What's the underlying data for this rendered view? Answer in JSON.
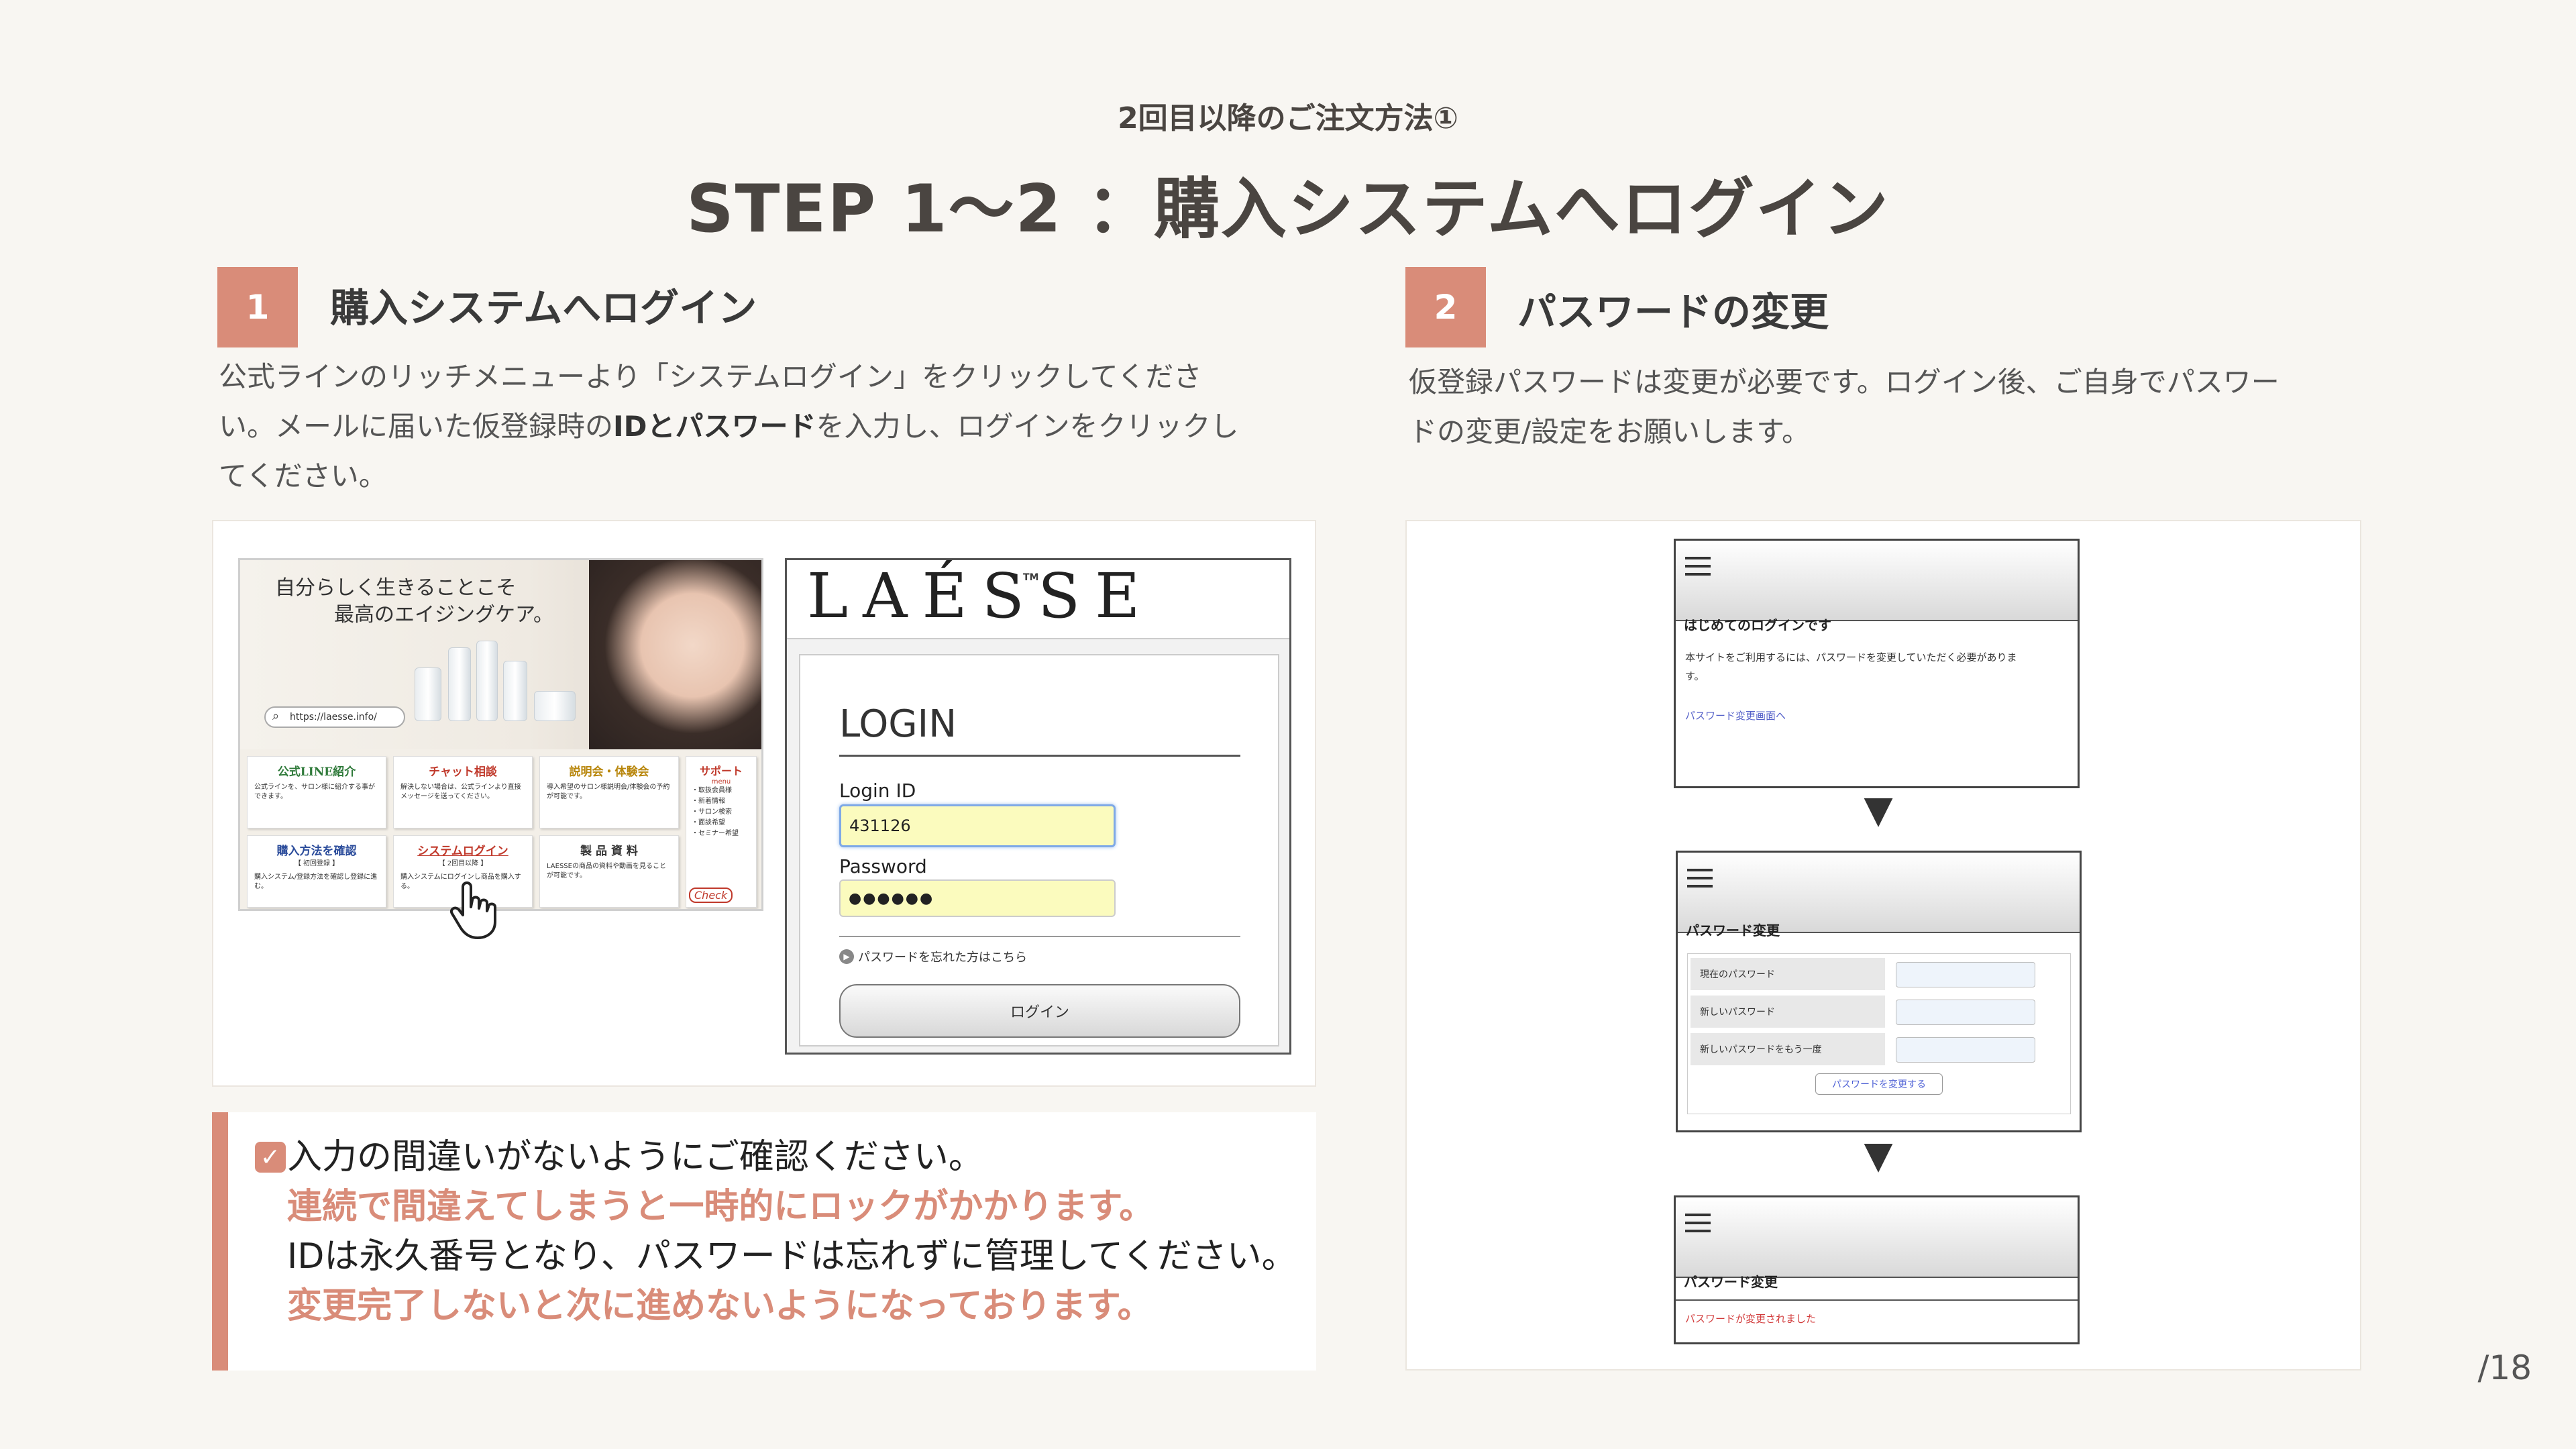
{
  "header": {
    "subtitle": "2回目以降のご注文方法①",
    "title": "STEP 1〜2 ：購入システムへログイン"
  },
  "step1": {
    "number": "1",
    "title": "購入システムへログイン",
    "desc_line1": "公式ラインのリッチメニューより「システムログイン」をクリックしてくださ",
    "desc_line2_a": "い。メールに届いた仮登録時の",
    "desc_line2_bold": "IDとパスワード",
    "desc_line2_b": "を入力し、ログインをクリックし",
    "desc_line3": "てください。"
  },
  "step2": {
    "number": "2",
    "title": "パスワードの変更",
    "desc_line1": "仮登録パスワードは変更が必要です。ログイン後、ご自身でパスワー",
    "desc_line2": "ドの変更/設定をお願いします。"
  },
  "richmenu": {
    "banner_line1": "自分らしく生きることこそ",
    "banner_line2": "最高のエイジングケア。",
    "url": "https://laesse.info/",
    "tiles": [
      {
        "title": "公式LINE紹介",
        "body": "公式ラインを、サロン様に紹介する事ができます。",
        "color": "#2f7a3a"
      },
      {
        "title": "チャット相談",
        "body": "解決しない場合は、公式ラインより直接メッセージを送ってください。",
        "color": "#c0392b"
      },
      {
        "title": "説明会・体験会",
        "body": "導入希望のサロン様説明会/体験会の予約が可能です。",
        "color": "#b8860b"
      },
      {
        "title": "購入方法を確認",
        "sub": "【 初回登録 】",
        "body": "購入システム/登録方法を確認し登録に進む。",
        "color": "#2b4c9b"
      },
      {
        "title": "システムログイン",
        "sub": "【 2回目以降 】",
        "body": "購入システムにログインし商品を購入する。",
        "color": "#c0392b"
      },
      {
        "title": "製 品 資 料",
        "body": "LAESSEの商品の資料や動画を見ることが可能です。",
        "color": "#333333"
      }
    ],
    "support_title": "サポート",
    "support_sub": "menu",
    "support_items": [
      "・取扱会員様",
      "・新着情報",
      "・サロン検索",
      "・面談希望",
      "・セミナー希望"
    ],
    "check_label": "Check"
  },
  "login": {
    "brand": "LAÉSSE",
    "tm": "TM",
    "heading": "LOGIN",
    "id_label": "Login ID",
    "id_value": "431126",
    "pw_label": "Password",
    "pw_value": "●●●●●●",
    "forgot": "パスワードを忘れた方はこちら",
    "button": "ログイン"
  },
  "notice": {
    "line1": "入力の間違いがないようにご確認ください。",
    "line2": "連続で間違えてしまうと一時的にロックがかかります。",
    "line3": "IDは永久番号となり、パスワードは忘れずに管理してください。",
    "line4": "変更完了しないと次に進めないようになっております。"
  },
  "phone1": {
    "title": "はじめてのログインです",
    "text_line1": "本サイトをご利用するには、パスワードを変更していただく必要がありま",
    "text_line2": "す。",
    "link": "パスワード変更画面へ"
  },
  "phone2": {
    "title": "パスワード変更",
    "rows": [
      "現在のパスワード",
      "新しいパスワード",
      "新しいパスワードをもう一度"
    ],
    "button": "パスワードを変更する"
  },
  "phone3": {
    "title": "パスワード変更",
    "message": "パスワードが変更されました"
  },
  "arrow": "▼",
  "page_number": "/18",
  "colors": {
    "accent": "#d98c79",
    "background": "#f8f6f2"
  }
}
